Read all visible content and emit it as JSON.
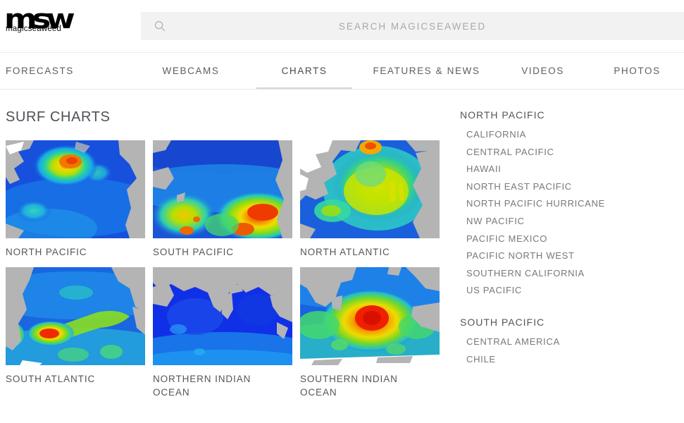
{
  "brand": {
    "logo_mark": "msw",
    "logo_word": "magicseaweed",
    "logo_icon_name": "magicseaweed-logo"
  },
  "search": {
    "placeholder": "SEARCH MAGICSEAWEED",
    "value": "",
    "icon": "search-icon"
  },
  "nav": {
    "items": [
      {
        "label": "FORECASTS",
        "active": false
      },
      {
        "label": "WEBCAMS",
        "active": false
      },
      {
        "label": "CHARTS",
        "active": true
      },
      {
        "label": "FEATURES & NEWS",
        "active": false
      },
      {
        "label": "VIDEOS",
        "active": false
      },
      {
        "label": "PHOTOS",
        "active": false
      }
    ]
  },
  "page": {
    "title": "SURF CHARTS"
  },
  "charts": [
    {
      "label": "NORTH PACIFIC",
      "region": "north-pacific"
    },
    {
      "label": "SOUTH PACIFIC",
      "region": "south-pacific"
    },
    {
      "label": "NORTH ATLANTIC",
      "region": "north-atlantic"
    },
    {
      "label": "SOUTH ATLANTIC",
      "region": "south-atlantic"
    },
    {
      "label": "NORTHERN INDIAN OCEAN",
      "region": "northern-indian-ocean"
    },
    {
      "label": "SOUTHERN INDIAN OCEAN",
      "region": "southern-indian-ocean"
    }
  ],
  "sidebar": {
    "sections": [
      {
        "heading": "NORTH PACIFIC",
        "links": [
          "CALIFORNIA",
          "CENTRAL PACIFIC",
          "HAWAII",
          "NORTH EAST PACIFIC",
          "NORTH PACIFIC HURRICANE",
          "NW PACIFIC",
          "PACIFIC MEXICO",
          "PACIFIC NORTH WEST",
          "SOUTHERN CALIFORNIA",
          "US PACIFIC"
        ]
      },
      {
        "heading": "SOUTH PACIFIC",
        "links": [
          "CENTRAL AMERICA",
          "CHILE"
        ]
      }
    ]
  },
  "colors": {
    "text_primary": "#55555d",
    "text_muted": "#77777f",
    "search_bg": "#f2f2f2",
    "rule": "#e6e6e6",
    "swell_low": "#1447d6",
    "swell_mid": "#21d0c8",
    "swell_high": "#e8e81a",
    "swell_max": "#e82a0a",
    "land": "#b4b4b4",
    "ice": "#ffffff"
  }
}
